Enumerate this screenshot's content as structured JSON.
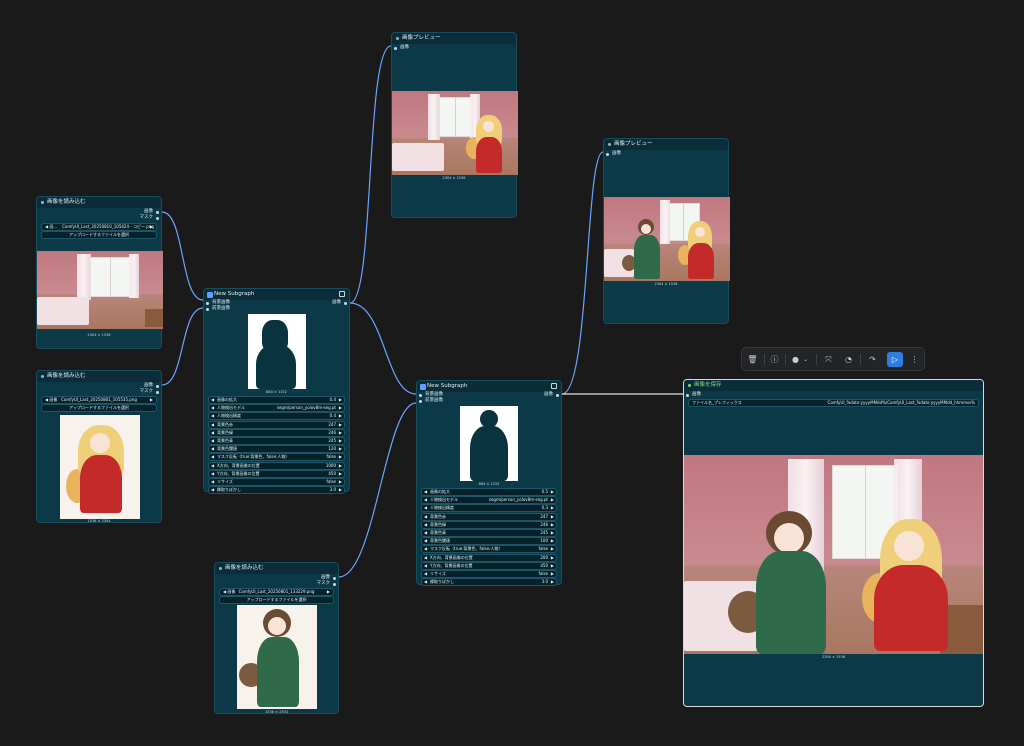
{
  "colors": {
    "canvas": "#1a1a1a",
    "node_bg": "#0c3947",
    "node_title": "#0a2d39",
    "wire": "#6aa4ff",
    "accent_run": "#2f7de1",
    "save_title": "#7fe07a"
  },
  "load1": {
    "title": "画像を読み込む",
    "out_image": "画像",
    "out_mask": "マスク",
    "widget_label": "画...",
    "widget_value": "ComfyUI_Last_20250810_105424 - コピー.png",
    "upload": "アップロードするファイルを選択",
    "caption": "2304 × 1536"
  },
  "load2": {
    "title": "画像を読み込む",
    "out_image": "画像",
    "out_mask": "マスク",
    "widget_label": "画像",
    "widget_value": "ComfyUI_Last_20250801_105535.png",
    "upload": "アップロードするファイルを選択",
    "caption": "1536 × 2304"
  },
  "load3": {
    "title": "画像を読み込む",
    "out_image": "画像",
    "out_mask": "マスク",
    "widget_label": "画像",
    "widget_value": "ComfyUI_Last_20250801_133229.png",
    "upload": "アップロードするファイルを選択",
    "caption": "1536 × 2304"
  },
  "sub1": {
    "title": "New Subgraph",
    "in_bg": "背景画像",
    "in_fg": "前景画像",
    "out_image": "画像",
    "caption": "884 × 1152",
    "widgets": [
      {
        "label": "画像の拡大",
        "value": "0.4"
      },
      {
        "label": "人物検出モデル",
        "value": "segm/person_yolov8m-seg.pt"
      },
      {
        "label": "人物検出精度",
        "value": "0.4"
      },
      {
        "label": "背景色赤",
        "value": "247"
      },
      {
        "label": "背景色緑",
        "value": "246"
      },
      {
        "label": "背景色青",
        "value": "245"
      },
      {
        "label": "背景色閾値",
        "value": "120"
      },
      {
        "label": "マスク反転（true:背景色、false:人物）",
        "value": "false"
      },
      {
        "label": "X方向、背景画像の位置",
        "value": "1000"
      },
      {
        "label": "Y方向、背景画像の位置",
        "value": "450"
      },
      {
        "label": "リサイズ",
        "value": "false"
      },
      {
        "label": "縁取りぼかし",
        "value": "3.0"
      }
    ]
  },
  "sub2": {
    "title": "New Subgraph",
    "in_bg": "背景画像",
    "in_fg": "前景画像",
    "out_image": "画像",
    "caption": "884 × 1152",
    "widgets": [
      {
        "label": "画像の拡大",
        "value": "0.5"
      },
      {
        "label": "人物検出モデル",
        "value": "segm/person_yolov8m-seg.pt"
      },
      {
        "label": "人物検出精度",
        "value": "0.3"
      },
      {
        "label": "背景色赤",
        "value": "247"
      },
      {
        "label": "背景色緑",
        "value": "246"
      },
      {
        "label": "背景色青",
        "value": "245"
      },
      {
        "label": "背景色閾値",
        "value": "100"
      },
      {
        "label": "マスク反転（true:背景色、false:人物）",
        "value": "false"
      },
      {
        "label": "X方向、背景画像の位置",
        "value": "200"
      },
      {
        "label": "Y方向、背景画像の位置",
        "value": "450"
      },
      {
        "label": "リサイズ",
        "value": "false"
      },
      {
        "label": "縁取りぼかし",
        "value": "3.0"
      }
    ]
  },
  "preview1": {
    "title": "画像プレビュー",
    "in_image": "画像",
    "caption": "2304 × 1536"
  },
  "preview2": {
    "title": "画像プレビュー",
    "in_image": "画像",
    "caption": "2304 × 1536"
  },
  "save": {
    "title": "画像を保存",
    "in_image": "画像",
    "widget_label": "ファイル名_プレフィックス",
    "widget_value": "ComfyUI_%date:yyyyMMdd%/ComfyUI_Last_%date:yyyyMMdd_hhmmss%",
    "caption": "2304 × 1536"
  },
  "toolbar": {
    "icons": [
      "trash-icon",
      "info-icon",
      "color-circle-icon",
      "chevron-down-icon",
      "fit-icon",
      "bypass-icon",
      "redo-icon",
      "run-icon",
      "more-icon"
    ]
  }
}
